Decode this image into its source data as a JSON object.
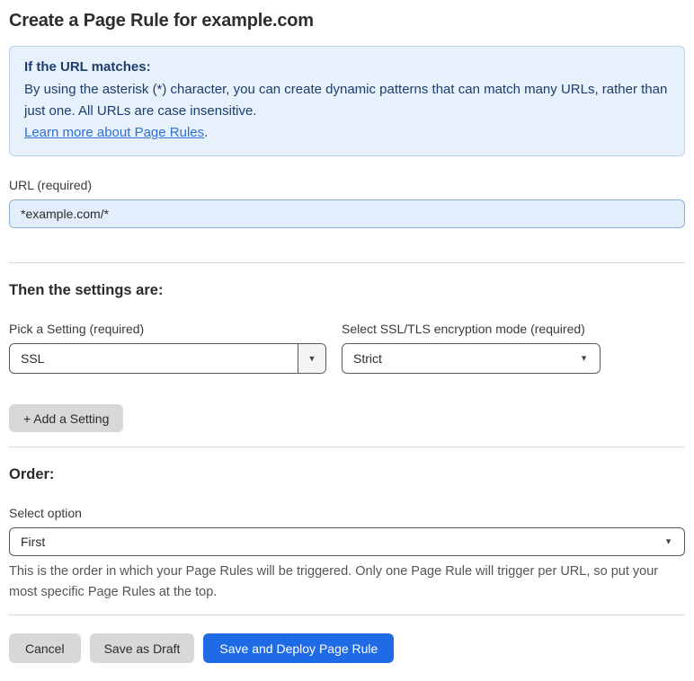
{
  "page": {
    "title": "Create a Page Rule for example.com"
  },
  "info_box": {
    "heading": "If the URL matches:",
    "body": "By using the asterisk (*) character, you can create dynamic patterns that can match many URLs, rather than just one. All URLs are case insensitive.",
    "link_label": "Learn more about Page Rules",
    "link_suffix": "."
  },
  "url_field": {
    "label": "URL (required)",
    "value": "*example.com/*"
  },
  "settings_section": {
    "heading": "Then the settings are:",
    "setting_picker": {
      "label": "Pick a Setting (required)",
      "value": "SSL"
    },
    "mode_picker": {
      "label": "Select SSL/TLS encryption mode (required)",
      "value": "Strict"
    },
    "add_setting_label": "+ Add a Setting"
  },
  "order_section": {
    "heading": "Order:",
    "select_label": "Select option",
    "value": "First",
    "help_text": "This is the order in which your Page Rules will be triggered. Only one Page Rule will trigger per URL, so put your most specific Page Rules at the top."
  },
  "footer": {
    "cancel_label": "Cancel",
    "save_draft_label": "Save as Draft",
    "save_deploy_label": "Save and Deploy Page Rule"
  },
  "icons": {
    "dropdown_caret": "▼"
  },
  "colors": {
    "info_bg": "#e7f1fb",
    "info_border": "#b9d2ef",
    "info_text": "#1d3d6f",
    "link_blue": "#2f6fd4",
    "input_bg": "#e3eefc",
    "input_border": "#8fb0d8",
    "primary_blue": "#1f6ae5",
    "gray_button": "#d8d8d8"
  }
}
